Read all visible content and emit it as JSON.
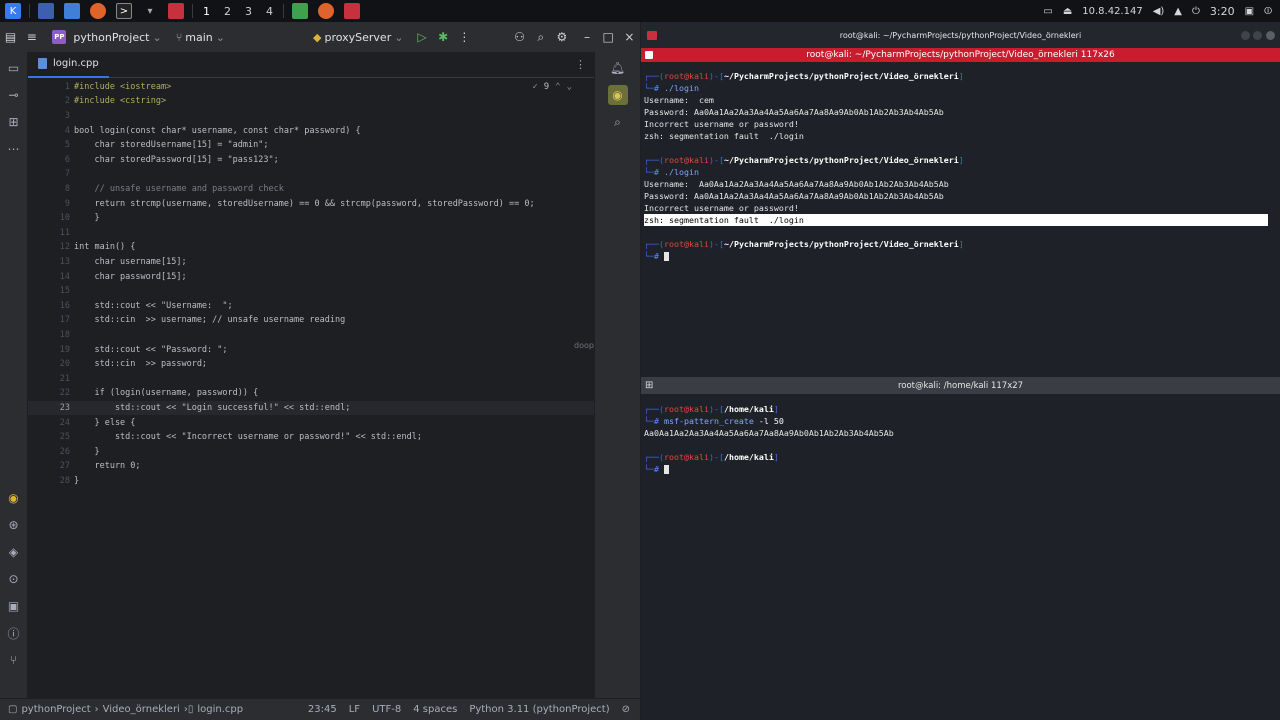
{
  "taskbar": {
    "workspaces": [
      "1",
      "2",
      "3",
      "4"
    ],
    "ip": "10.8.42.147",
    "clock": "3:20"
  },
  "ide": {
    "project_badge": "PP",
    "project_name": "pythonProject",
    "branch": "main",
    "run_config": "proxyServer",
    "tab_label": "login.cpp",
    "inspection_count": "9",
    "code_lines": [
      {
        "n": "1",
        "t": "#include <iostream>"
      },
      {
        "n": "2",
        "t": "#include <cstring>"
      },
      {
        "n": "3",
        "t": ""
      },
      {
        "n": "4",
        "t": "bool login(const char* username, const char* password) {"
      },
      {
        "n": "5",
        "t": "    char storedUsername[15] = \"admin\";"
      },
      {
        "n": "6",
        "t": "    char storedPassword[15] = \"pass123\";"
      },
      {
        "n": "7",
        "t": ""
      },
      {
        "n": "8",
        "t": "    // unsafe username and password check"
      },
      {
        "n": "9",
        "t": "    return strcmp(username, storedUsername) == 0 && strcmp(password, storedPassword) == 0;"
      },
      {
        "n": "10",
        "t": "    }"
      },
      {
        "n": "11",
        "t": ""
      },
      {
        "n": "12",
        "t": "int main() {"
      },
      {
        "n": "13",
        "t": "    char username[15];"
      },
      {
        "n": "14",
        "t": "    char password[15];"
      },
      {
        "n": "15",
        "t": ""
      },
      {
        "n": "16",
        "t": "    std::cout << \"Username:  \";"
      },
      {
        "n": "17",
        "t": "    std::cin  >> username; // unsafe username reading"
      },
      {
        "n": "18",
        "t": ""
      },
      {
        "n": "19",
        "t": "    std::cout << \"Password: \";"
      },
      {
        "n": "20",
        "t": "    std::cin  >> password;"
      },
      {
        "n": "21",
        "t": ""
      },
      {
        "n": "22",
        "t": "    if (login(username, password)) {"
      },
      {
        "n": "23",
        "t": "        std::cout << \"Login successful!\" << std::endl;"
      },
      {
        "n": "24",
        "t": "    } else {"
      },
      {
        "n": "25",
        "t": "        std::cout << \"Incorrect username or password!\" << std::endl;"
      },
      {
        "n": "26",
        "t": "    }"
      },
      {
        "n": "27",
        "t": "    return 0;"
      },
      {
        "n": "28",
        "t": "}"
      }
    ],
    "side_hint": "doop",
    "status": {
      "crumb_project": "pythonProject",
      "crumb_folder": "Video_örnekleri",
      "crumb_file": "login.cpp",
      "position": "23:45",
      "line_sep": "LF",
      "encoding": "UTF-8",
      "indent": "4 spaces",
      "interpreter": "Python 3.11 (pythonProject)"
    }
  },
  "terminal1": {
    "title": "root@kali: ~/PycharmProjects/pythonProject/Video_örnekleri",
    "tab_title": "root@kali: ~/PycharmProjects/pythonProject/Video_örnekleri 117x26",
    "prompt_user": "root@kali",
    "prompt_path": "~/PycharmProjects/pythonProject/Video_örnekleri",
    "cmd": "./login",
    "run1": [
      "Username:  cem",
      "Password: Aa0Aa1Aa2Aa3Aa4Aa5Aa6Aa7Aa8Aa9Ab0Ab1Ab2Ab3Ab4Ab5Ab",
      "Incorrect username or password!",
      "zsh: segmentation fault  ./login"
    ],
    "run2": [
      "Username:  Aa0Aa1Aa2Aa3Aa4Aa5Aa6Aa7Aa8Aa9Ab0Ab1Ab2Ab3Ab4Ab5Ab",
      "Password: Aa0Aa1Aa2Aa3Aa4Aa5Aa6Aa7Aa8Aa9Ab0Ab1Ab2Ab3Ab4Ab5Ab",
      "Incorrect username or password!",
      "zsh: segmentation fault  ./login"
    ]
  },
  "terminal2": {
    "title": "root@kali: /home/kali 117x27",
    "prompt_user": "root@kali",
    "prompt_path": "/home/kali",
    "cmd_name": "msf-pattern_create",
    "cmd_args": " -l 50",
    "output": "Aa0Aa1Aa2Aa3Aa4Aa5Aa6Aa7Aa8Aa9Ab0Ab1Ab2Ab3Ab4Ab5Ab"
  }
}
